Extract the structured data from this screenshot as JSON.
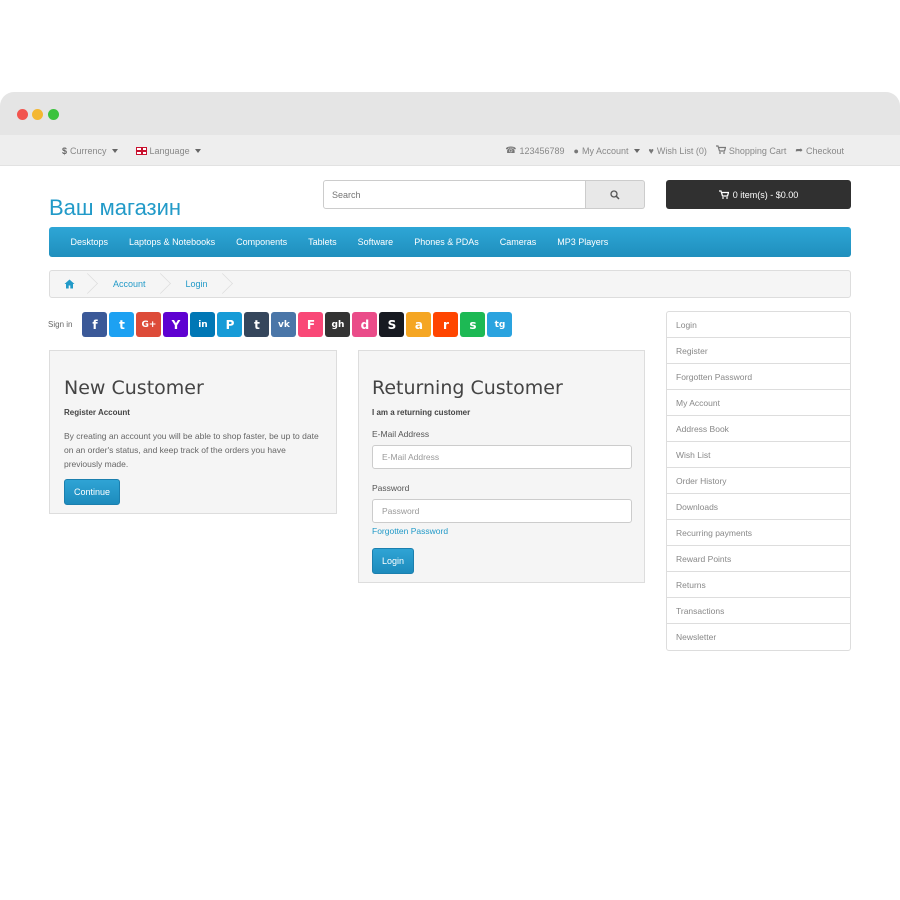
{
  "topbar": {
    "currency": "Currency",
    "currency_symbol": "$",
    "language": "Language",
    "phone": "123456789",
    "my_account": "My Account",
    "wishlist": "Wish List (0)",
    "shopping_cart": "Shopping Cart",
    "checkout": "Checkout"
  },
  "header": {
    "logo": "Ваш магазин",
    "search_placeholder": "Search",
    "cart": "0 item(s) - $0.00"
  },
  "menu": [
    "Desktops",
    "Laptops & Notebooks",
    "Components",
    "Tablets",
    "Software",
    "Phones & PDAs",
    "Cameras",
    "MP3 Players"
  ],
  "breadcrumb": [
    "Account",
    "Login"
  ],
  "signin": {
    "label": "Sign in",
    "providers": [
      {
        "name": "facebook",
        "glyph": "f",
        "color": "#3b5998"
      },
      {
        "name": "twitter",
        "glyph": "t",
        "color": "#1da1f2"
      },
      {
        "name": "google-plus",
        "glyph": "G+",
        "color": "#dd4b39"
      },
      {
        "name": "yahoo",
        "glyph": "Y",
        "color": "#5f01d1"
      },
      {
        "name": "linkedin",
        "glyph": "in",
        "color": "#0077b5"
      },
      {
        "name": "paypal",
        "glyph": "P",
        "color": "#169bd7"
      },
      {
        "name": "tumblr",
        "glyph": "t",
        "color": "#35465c"
      },
      {
        "name": "vk",
        "glyph": "vk",
        "color": "#4a76a8"
      },
      {
        "name": "foursquare",
        "glyph": "F",
        "color": "#f94877"
      },
      {
        "name": "github",
        "glyph": "gh",
        "color": "#333333"
      },
      {
        "name": "dribbble",
        "glyph": "d",
        "color": "#ea4c89"
      },
      {
        "name": "steam",
        "glyph": "S",
        "color": "#171a21"
      },
      {
        "name": "amazon",
        "glyph": "a",
        "color": "#f5a623"
      },
      {
        "name": "reddit",
        "glyph": "r",
        "color": "#ff4500"
      },
      {
        "name": "spotify",
        "glyph": "s",
        "color": "#1db954"
      },
      {
        "name": "telegram",
        "glyph": "tg",
        "color": "#2aa3df"
      }
    ]
  },
  "new_customer": {
    "title": "New Customer",
    "subtitle": "Register Account",
    "text": "By creating an account you will be able to shop faster, be up to date on an order's status, and keep track of the orders you have previously made.",
    "button": "Continue"
  },
  "returning_customer": {
    "title": "Returning Customer",
    "subtitle": "I am a returning customer",
    "email_label": "E-Mail Address",
    "email_placeholder": "E-Mail Address",
    "password_label": "Password",
    "password_placeholder": "Password",
    "forgot": "Forgotten Password",
    "button": "Login"
  },
  "sidebar": [
    "Login",
    "Register",
    "Forgotten Password",
    "My Account",
    "Address Book",
    "Wish List",
    "Order History",
    "Downloads",
    "Recurring payments",
    "Reward Points",
    "Returns",
    "Transactions",
    "Newsletter"
  ],
  "colors": {
    "accent": "#229ac8",
    "cart_bg": "#303030",
    "menu_bg": "#229ac8"
  }
}
